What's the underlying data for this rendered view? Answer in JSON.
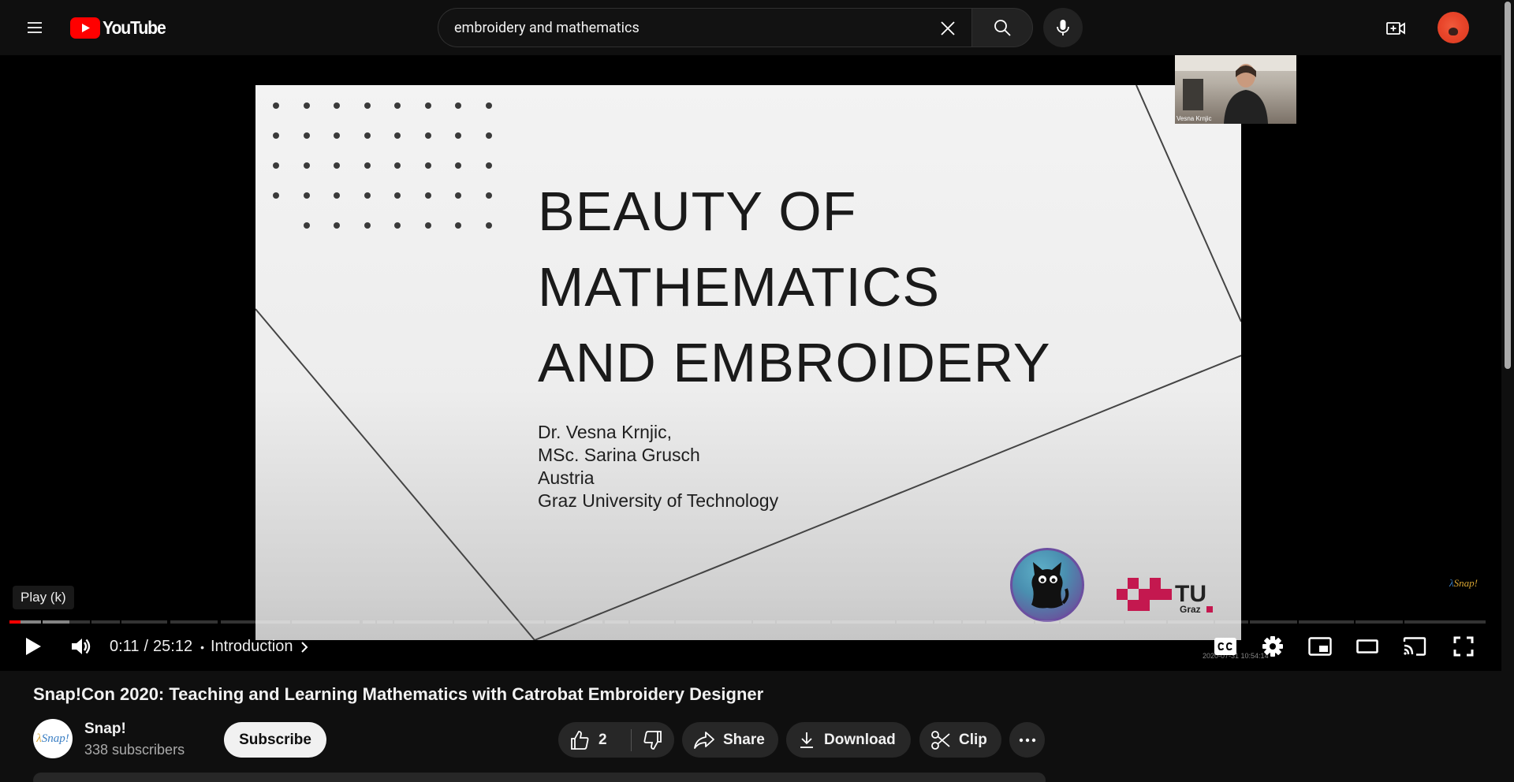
{
  "masthead": {
    "logo_text": "YouTube",
    "search_value": "embroidery and mathematics",
    "avatar_color": "#e8452a"
  },
  "player": {
    "slide": {
      "title_lines": [
        "BEAUTY OF",
        "MATHEMATICS",
        "AND EMBROIDERY"
      ],
      "author_lines": [
        "Dr. Vesna Krnjic,",
        "MSc. Sarina Grusch",
        "Austria",
        "Graz University of Technology"
      ],
      "tu_logo_text": "TU",
      "tu_logo_sub": "Graz"
    },
    "webcam_name": "Vesna Krnjic",
    "watermark_lambda": "λ",
    "watermark_text": "Snap!",
    "timestamp": "2020-07-31 10:54:14",
    "tooltip": "Play (k)",
    "progress_played_fraction": 0.0073,
    "time_current": "0:11",
    "time_separator": "/",
    "time_total": "25:12",
    "chapter_dot": "•",
    "chapter_title": "Introduction",
    "accent_color": "#ff0000"
  },
  "video": {
    "title": "Snap!Con 2020: Teaching and Learning Mathematics with Catrobat Embroidery Designer",
    "channel_name": "Snap!",
    "channel_avatar_lambda": "λ",
    "channel_avatar_text": "Snap!",
    "subscribers": "338 subscribers",
    "subscribe_label": "Subscribe",
    "like_count": "2",
    "share_label": "Share",
    "download_label": "Download",
    "clip_label": "Clip"
  }
}
